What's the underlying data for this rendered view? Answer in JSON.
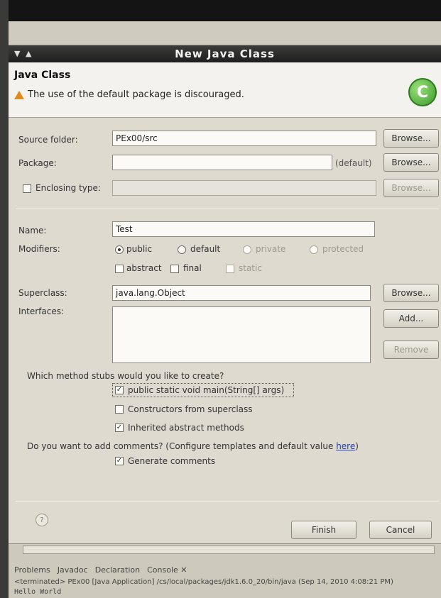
{
  "window": {
    "title": "New Java Class",
    "controls": "▼ ▲"
  },
  "banner": {
    "title": "Java Class",
    "warning": "The use of the default package is discouraged.",
    "logo_letter": "C"
  },
  "form": {
    "source_folder": {
      "label": "Source folder:",
      "value": "PEx00/src",
      "button": "Browse..."
    },
    "package": {
      "label": "Package:",
      "value": "",
      "hint": "(default)",
      "button": "Browse..."
    },
    "enclosing": {
      "label": "Enclosing type:",
      "value": "",
      "button": "Browse...",
      "checked": false
    },
    "name": {
      "label": "Name:",
      "value": "Test"
    },
    "modifiers": {
      "label": "Modifiers:",
      "options": [
        "public",
        "default",
        "private",
        "protected"
      ],
      "selected": "public",
      "extra": [
        "abstract",
        "final",
        "static"
      ]
    },
    "superclass": {
      "label": "Superclass:",
      "value": "java.lang.Object",
      "button": "Browse..."
    },
    "interfaces": {
      "label": "Interfaces:",
      "add_button": "Add...",
      "remove_button": "Remove"
    },
    "stubs": {
      "question": "Which method stubs would you like to create?",
      "items": [
        {
          "label": "public static void main(String[] args)",
          "checked": true
        },
        {
          "label": "Constructors from superclass",
          "checked": false
        },
        {
          "label": "Inherited abstract methods",
          "checked": true
        }
      ]
    },
    "comments": {
      "question": "Do you want to add comments? (Configure templates and default value ",
      "link": "here",
      "tail": ")",
      "item": {
        "label": "Generate comments",
        "checked": true
      }
    }
  },
  "footer": {
    "help": "?",
    "finish": "Finish",
    "cancel": "Cancel"
  },
  "bottom": {
    "tabs": [
      "Problems",
      "Javadoc",
      "Declaration",
      "Console ✕"
    ],
    "console_header": "<terminated> PEx00 [Java Application] /cs/local/packages/jdk1.6.0_20/bin/java (Sep 14, 2010 4:08:21 PM)",
    "console_output": "Hello World"
  },
  "colors": {
    "titlebar": "#1e1e1d",
    "dialog_bg": "#dedad0",
    "banner_bg": "#f3f2ee",
    "warning": "#e08a1a",
    "logo": "#3a9a2a"
  }
}
